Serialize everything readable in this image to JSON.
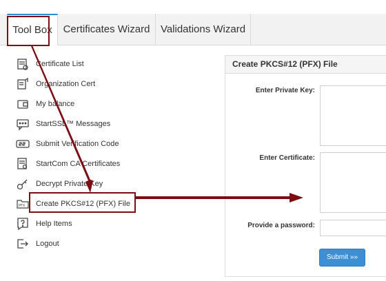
{
  "tabs": [
    {
      "label": "Tool Box"
    },
    {
      "label": "Certificates Wizard"
    },
    {
      "label": "Validations Wizard"
    }
  ],
  "sidebar": {
    "items": [
      {
        "label": "Certificate List",
        "icon": "certificate-list-icon"
      },
      {
        "label": "Organization Cert",
        "icon": "organization-cert-icon"
      },
      {
        "label": "My balance",
        "icon": "wallet-icon"
      },
      {
        "label": "StartSSL™ Messages",
        "icon": "message-icon"
      },
      {
        "label": "Submit Verification Code",
        "icon": "ssl-code-icon"
      },
      {
        "label": "StartCom CA Certificates",
        "icon": "ca-certificates-icon"
      },
      {
        "label": "Decrypt Private Key",
        "icon": "key-icon"
      },
      {
        "label": "Create PKCS#12 (PFX) File",
        "icon": "pfx-file-icon"
      },
      {
        "label": "Help Items",
        "icon": "help-icon"
      },
      {
        "label": "Logout",
        "icon": "logout-icon"
      }
    ]
  },
  "panel": {
    "title": "Create PKCS#12 (PFX) File",
    "private_key_label": "Enter Private Key:",
    "certificate_label": "Enter Certificate:",
    "password_label": "Provide a password:",
    "submit_label": "Submit »»"
  },
  "colors": {
    "accent": "#2a8bd0",
    "submit": "#3c8fd5",
    "annotation": "#7a0e14"
  }
}
